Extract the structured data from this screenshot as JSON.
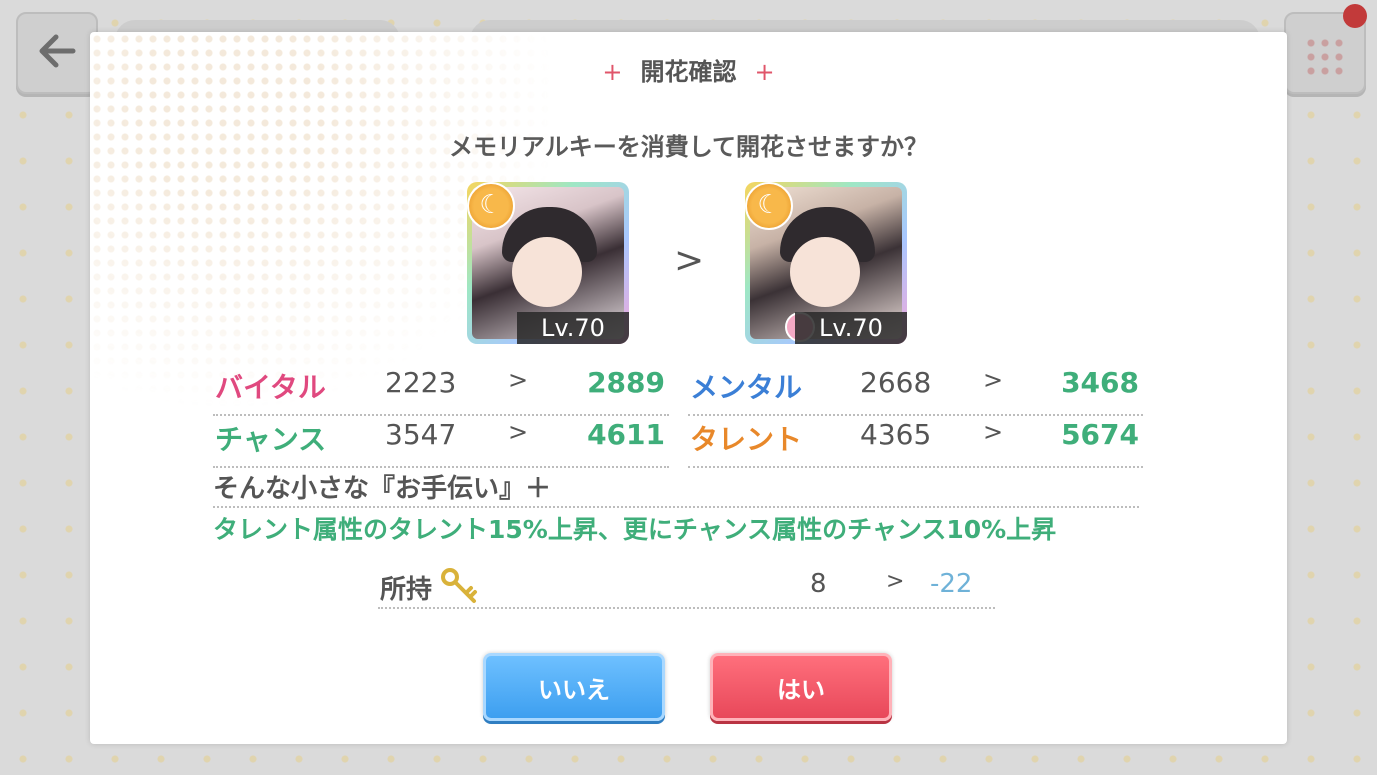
{
  "dialog": {
    "title": "開花確認",
    "title_plus": "+",
    "question": "メモリアルキーを消費して開花させますか？"
  },
  "cards": {
    "before_level": "Lv.70",
    "after_level": "Lv.70",
    "arrow": ">"
  },
  "stats": [
    {
      "label": "バイタル",
      "before": "2223",
      "after": "2889",
      "color": "#e0497f"
    },
    {
      "label": "メンタル",
      "before": "2668",
      "after": "3468",
      "color": "#3b7fd6"
    },
    {
      "label": "チャンス",
      "before": "3547",
      "after": "4611",
      "color": "#3fae7a"
    },
    {
      "label": "タレント",
      "before": "4365",
      "after": "5674",
      "color": "#e8882a"
    }
  ],
  "stat_arrow": ">",
  "skill": {
    "name": "そんな小さな『お手伝い』＋",
    "description": "タレント属性のタレント15%上昇、更にチャンス属性のチャンス10%上昇"
  },
  "ownership": {
    "label": "所持",
    "current": "8",
    "after": "-22",
    "arrow": ">"
  },
  "buttons": {
    "no_label": "いいえ",
    "yes_label": "はい"
  },
  "icons": {
    "back": "back-arrow-icon",
    "menu": "grid-menu-icon",
    "attribute": "moon-attribute-icon",
    "bloom": "flower-bloom-icon",
    "key": "memorial-key-icon"
  },
  "colors": {
    "value_up": "#3fae7a",
    "key_after": "#6fb2d8",
    "no_button": "#3d9ff0",
    "yes_button": "#e8485a",
    "title_plus": "#e0556a"
  }
}
